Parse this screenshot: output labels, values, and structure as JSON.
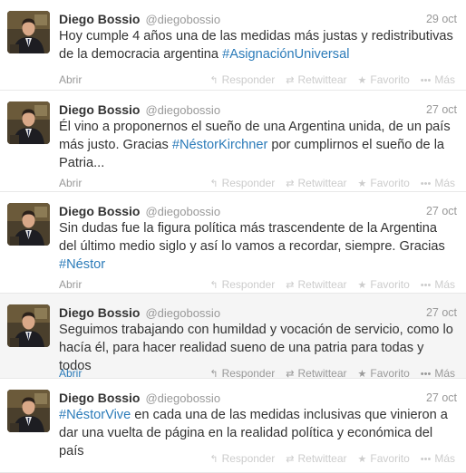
{
  "tweets": [
    {
      "name": "Diego Bossio",
      "handle": "@diegobossio",
      "date": "29 oct",
      "text_before": "Hoy cumple 4 años una de las medidas más justas y redistributivas de la democracia argentina ",
      "hashtag": "#AsignaciónUniversal",
      "text_after": "",
      "expand": "Abrir"
    },
    {
      "name": "Diego Bossio",
      "handle": "@diegobossio",
      "date": "27 oct",
      "text_before": "Él vino a proponernos el sueño de una Argentina unida, de un país más justo. Gracias ",
      "hashtag": "#NéstorKirchner",
      "text_after": " por cumplirnos el sueño de la Patria...",
      "expand": "Abrir"
    },
    {
      "name": "Diego Bossio",
      "handle": "@diegobossio",
      "date": "27 oct",
      "text_before": "Sin dudas fue la figura política más trascendente de la Argentina del último medio siglo y así lo vamos a recordar, siempre. Gracias ",
      "hashtag": "#Néstor",
      "text_after": "",
      "expand": "Abrir"
    },
    {
      "name": "Diego Bossio",
      "handle": "@diegobossio",
      "date": "27 oct",
      "text_before": "Seguimos trabajando con humildad y vocación de servicio, como lo hacía él, para hacer realidad sueno de una patria para todas y todos",
      "hashtag": "",
      "text_after": "",
      "expand": "Abrir"
    },
    {
      "name": "Diego Bossio",
      "handle": "@diegobossio",
      "date": "27 oct",
      "text_before": "",
      "hashtag": "#NéstorVive",
      "text_after": " en cada una de las medidas inclusivas que vinieron a dar una vuelta de página en la realidad política y económica del país",
      "expand": ""
    }
  ],
  "actions": {
    "reply_label": "Responder",
    "retweet_label": "Retwittear",
    "favorite_label": "Favorito",
    "more_label": "Más",
    "reply_icon": "reply-arrow-icon",
    "retweet_icon": "retweet-icon",
    "favorite_icon": "star-icon",
    "more_icon": "ellipsis-icon"
  },
  "colors": {
    "hashtag": "#2b7bb9",
    "hover_background": "#f5f5f5",
    "muted": "#999999"
  }
}
